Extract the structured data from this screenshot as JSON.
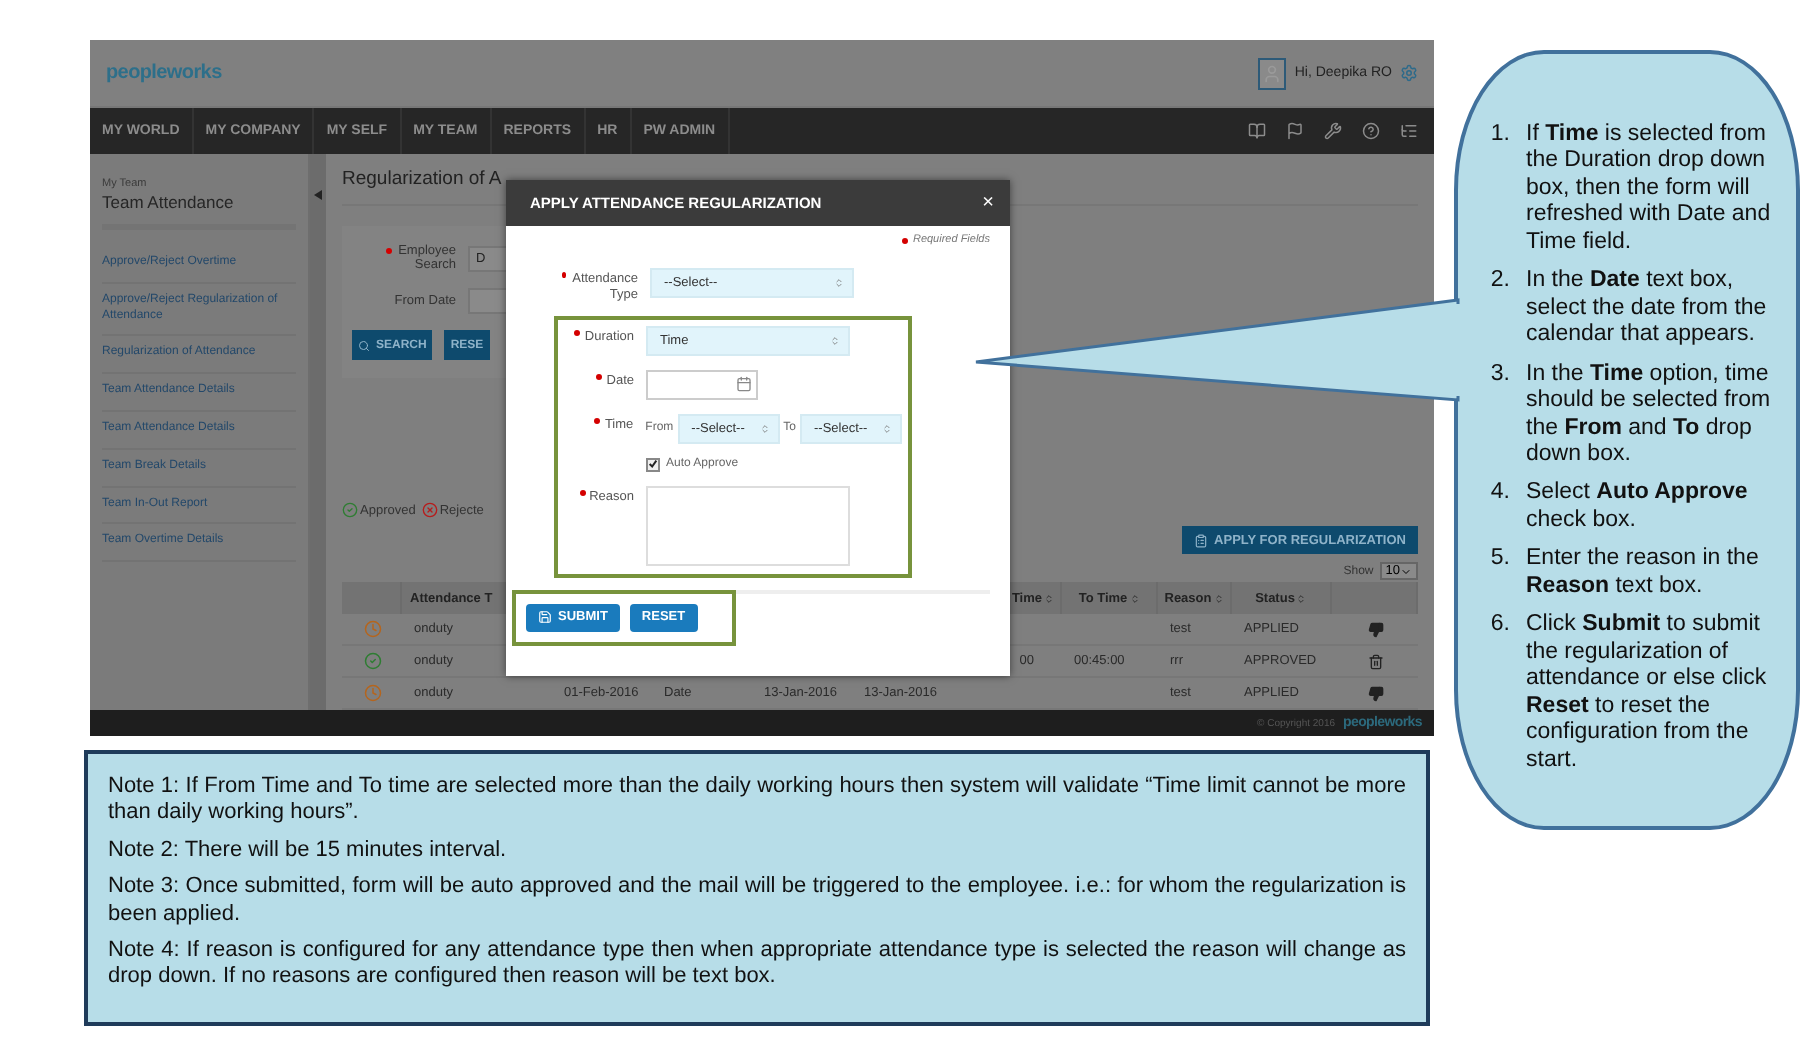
{
  "app": {
    "header": {
      "logo": "peopleworks",
      "greeting": "Hi, Deepika RO"
    },
    "nav": [
      "MY WORLD",
      "MY COMPANY",
      "MY SELF",
      "MY TEAM",
      "REPORTS",
      "HR",
      "PW ADMIN"
    ],
    "sidebar": {
      "section": "My Team",
      "title": "Team Attendance",
      "items": [
        "Approve/Reject Overtime",
        "Approve/Reject Regularization of Attendance",
        "Regularization of Attendance",
        "Team Attendance Details",
        "Team Attendance Details",
        "Team Break Details",
        "Team In-Out Report",
        "Team Overtime Details"
      ]
    },
    "page_title": "Regularization of A",
    "filters": {
      "employee_search_label": "Employee Search",
      "employee_search_value": "D",
      "from_date_label": "From Date",
      "search_button": "SEARCH",
      "reset_button": "RESE"
    },
    "legend": [
      {
        "kind": "approved",
        "label": "Approved"
      },
      {
        "kind": "rejected",
        "label": "Rejecte"
      }
    ],
    "apply_button": "APPLY FOR REGULARIZATION",
    "show": {
      "label": "Show",
      "value": "10"
    },
    "table": {
      "columns": {
        "attendance_type": "Attendance T",
        "from_time": "Time",
        "to_time": "To Time",
        "reason": "Reason",
        "status": "Status"
      },
      "rows": [
        {
          "kind": "pending",
          "attendance_type": "onduty",
          "reason": "test",
          "status": "APPLIED"
        },
        {
          "kind": "approved",
          "attendance_type": "onduty",
          "from_time": "00",
          "to_time": "00:45:00",
          "reason": "rrr",
          "status": "APPROVED"
        },
        {
          "kind": "pending",
          "attendance_type": "onduty",
          "date": "01-Feb-2016",
          "duration": "Date",
          "from_date": "13-Jan-2016",
          "to_date": "13-Jan-2016",
          "reason": "test",
          "status": "APPLIED"
        }
      ]
    },
    "footer": {
      "copyright": "© Copyright 2016",
      "logo": "peopleworks"
    }
  },
  "dialog": {
    "title": "APPLY ATTENDANCE REGULARIZATION",
    "close": "×",
    "required_note": "Required Fields",
    "fields": [
      {
        "kind": "select",
        "label": "Attendance Type",
        "required": true,
        "value": "--Select--",
        "highlighted": false
      },
      {
        "kind": "select",
        "label": "Duration",
        "required": true,
        "value": "Time",
        "highlighted": true
      },
      {
        "kind": "date",
        "label": "Date",
        "required": true,
        "highlighted": true
      },
      {
        "kind": "time_range",
        "label": "Time",
        "required": true,
        "from_label": "From",
        "from_value": "--Select--",
        "to_label": "To",
        "to_value": "--Select--",
        "highlighted": true
      },
      {
        "kind": "checkbox",
        "label": "Auto Approve",
        "checked": true,
        "highlighted": true
      },
      {
        "kind": "textarea",
        "label": "Reason",
        "required": true,
        "highlighted": true
      }
    ],
    "submit": "SUBMIT",
    "reset": "RESET"
  },
  "steps": [
    {
      "number": "1.",
      "text": "If **Time** is selected from the Duration drop down box, then the form will refreshed with Date and Time field."
    },
    {
      "number": "2.",
      "text": "In the **Date** text box, select the date from the calendar that appears."
    },
    {
      "number": "3.",
      "text": "In the **Time** option, time should be selected from the **From** and **To** drop down box."
    },
    {
      "number": "4.",
      "text": "Select **Auto Approve** check box."
    },
    {
      "number": "5.",
      "text": "Enter the reason in the **Reason** text box."
    },
    {
      "number": "6.",
      "text": "Click **Submit** to submit the regularization of attendance or else click **Reset** to reset the configuration from the start."
    }
  ],
  "notes": [
    "Note 1: If From Time and To time are selected more than the daily working hours then system will validate “Time limit cannot be more than daily working hours”.",
    "Note 2: There will be 15 minutes interval.",
    "Note 3: Once submitted, form will be auto approved and the mail will be triggered to the employee. i.e.: for whom the regularization is been applied.",
    "Note 4: If reason is configured for any attendance type then when appropriate attendance type is selected the reason will change as drop down. If no reasons are configured then reason will be text box."
  ]
}
